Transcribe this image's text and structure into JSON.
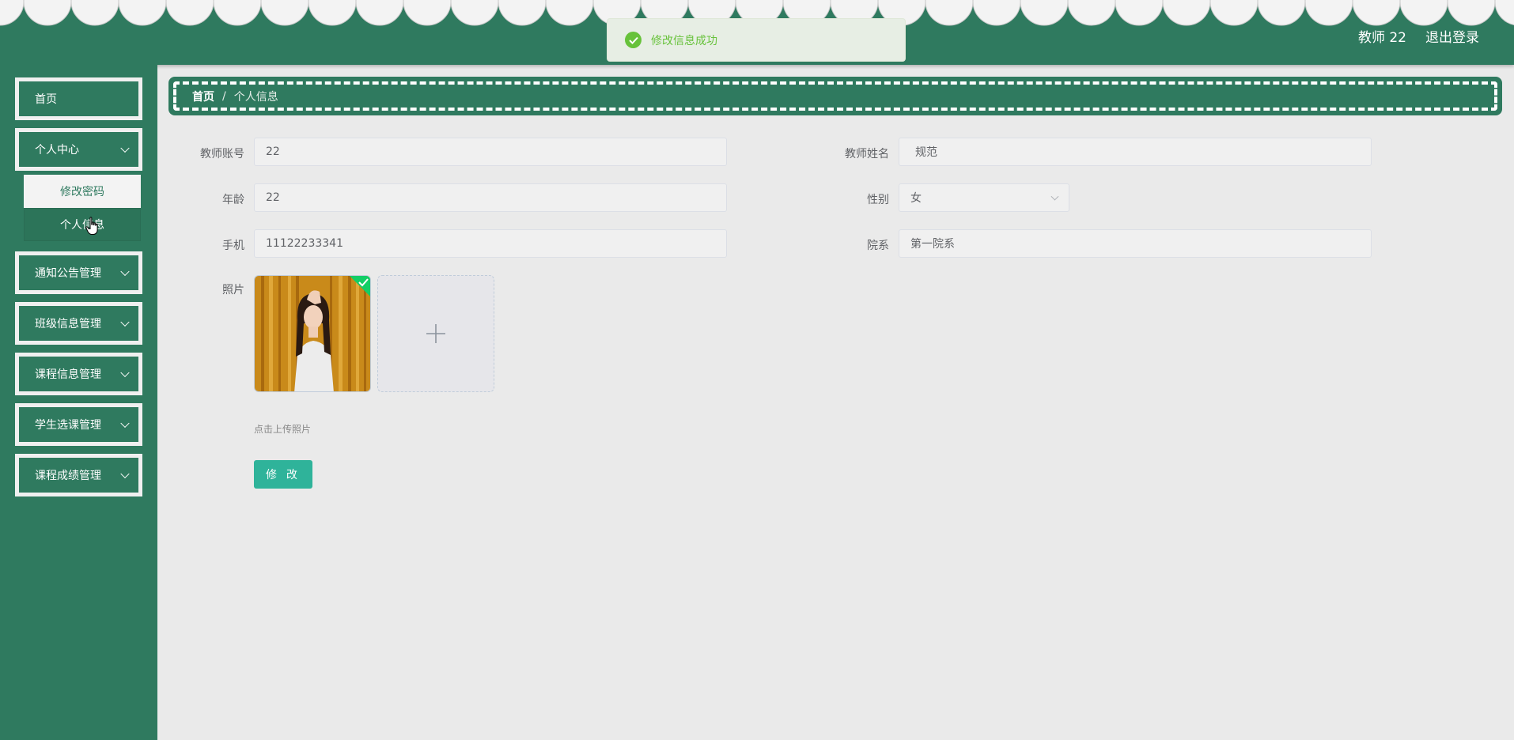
{
  "colors": {
    "primary": "#2f7a5f",
    "page_background": "#eaeaea",
    "success": "#67c23a",
    "button": "#2fb39a"
  },
  "header": {
    "user_label": "教师 22",
    "logout_label": "退出登录"
  },
  "toast": {
    "message": "修改信息成功",
    "icon": "check-circle-icon"
  },
  "sidebar": {
    "items": [
      {
        "label": "首页"
      },
      {
        "label": "个人中心",
        "expanded": true
      },
      {
        "label": "通知公告管理"
      },
      {
        "label": "班级信息管理"
      },
      {
        "label": "课程信息管理"
      },
      {
        "label": "学生选课管理"
      },
      {
        "label": "课程成绩管理"
      }
    ],
    "submenu": [
      {
        "label": "修改密码"
      },
      {
        "label": "个人信息",
        "active": true
      }
    ]
  },
  "breadcrumb": {
    "home": "首页",
    "separator": "/",
    "current": "个人信息"
  },
  "form": {
    "account": {
      "label": "教师账号",
      "value": "22"
    },
    "name": {
      "label": "教师姓名",
      "value": "规范"
    },
    "age": {
      "label": "年龄",
      "value": "22"
    },
    "gender": {
      "label": "性别",
      "value": "女"
    },
    "phone": {
      "label": "手机",
      "value": "11122233341"
    },
    "department": {
      "label": "院系",
      "value": "第一院系"
    },
    "photo": {
      "label": "照片",
      "hint": "点击上传照片"
    },
    "submit_label": "修 改"
  }
}
